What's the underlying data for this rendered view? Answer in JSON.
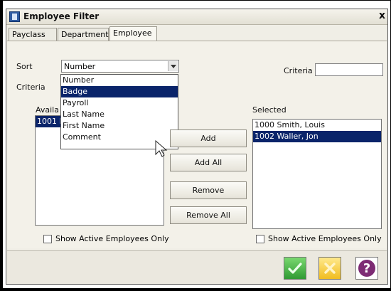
{
  "window": {
    "title": "Employee Filter",
    "close_label": "x"
  },
  "tabs": [
    {
      "label": "Payclass"
    },
    {
      "label": "Department"
    },
    {
      "label": "Employee"
    }
  ],
  "sort": {
    "label": "Sort",
    "selected": "Number",
    "options": [
      "Number",
      "Badge",
      "Payroll",
      "Last Name",
      "First Name",
      "Comment"
    ],
    "highlighted_option": "Badge"
  },
  "criteria": {
    "left_label": "Criteria",
    "right_label": "Criteria",
    "value": ""
  },
  "available": {
    "label_visible": "Availa",
    "items": [
      "1001 I"
    ]
  },
  "selected": {
    "label": "Selected",
    "items": [
      "1000 Smith, Louis",
      "1002 Waller, Jon"
    ],
    "highlighted_item": "1002 Waller, Jon"
  },
  "buttons": {
    "add": "Add",
    "add_all": "Add All",
    "remove": "Remove",
    "remove_all": "Remove All"
  },
  "checkboxes": {
    "left": "Show Active Employees Only",
    "right": "Show Active Employees Only"
  },
  "actions": {
    "ok_icon": "check-icon",
    "cancel_icon": "cancel-icon",
    "help_icon": "help-icon",
    "help_text": "?"
  },
  "colors": {
    "selection": "#0a246a",
    "ok_green": "#2f9a33",
    "cancel_yellow": "#f1bd20",
    "help_purple": "#7d2b74"
  }
}
